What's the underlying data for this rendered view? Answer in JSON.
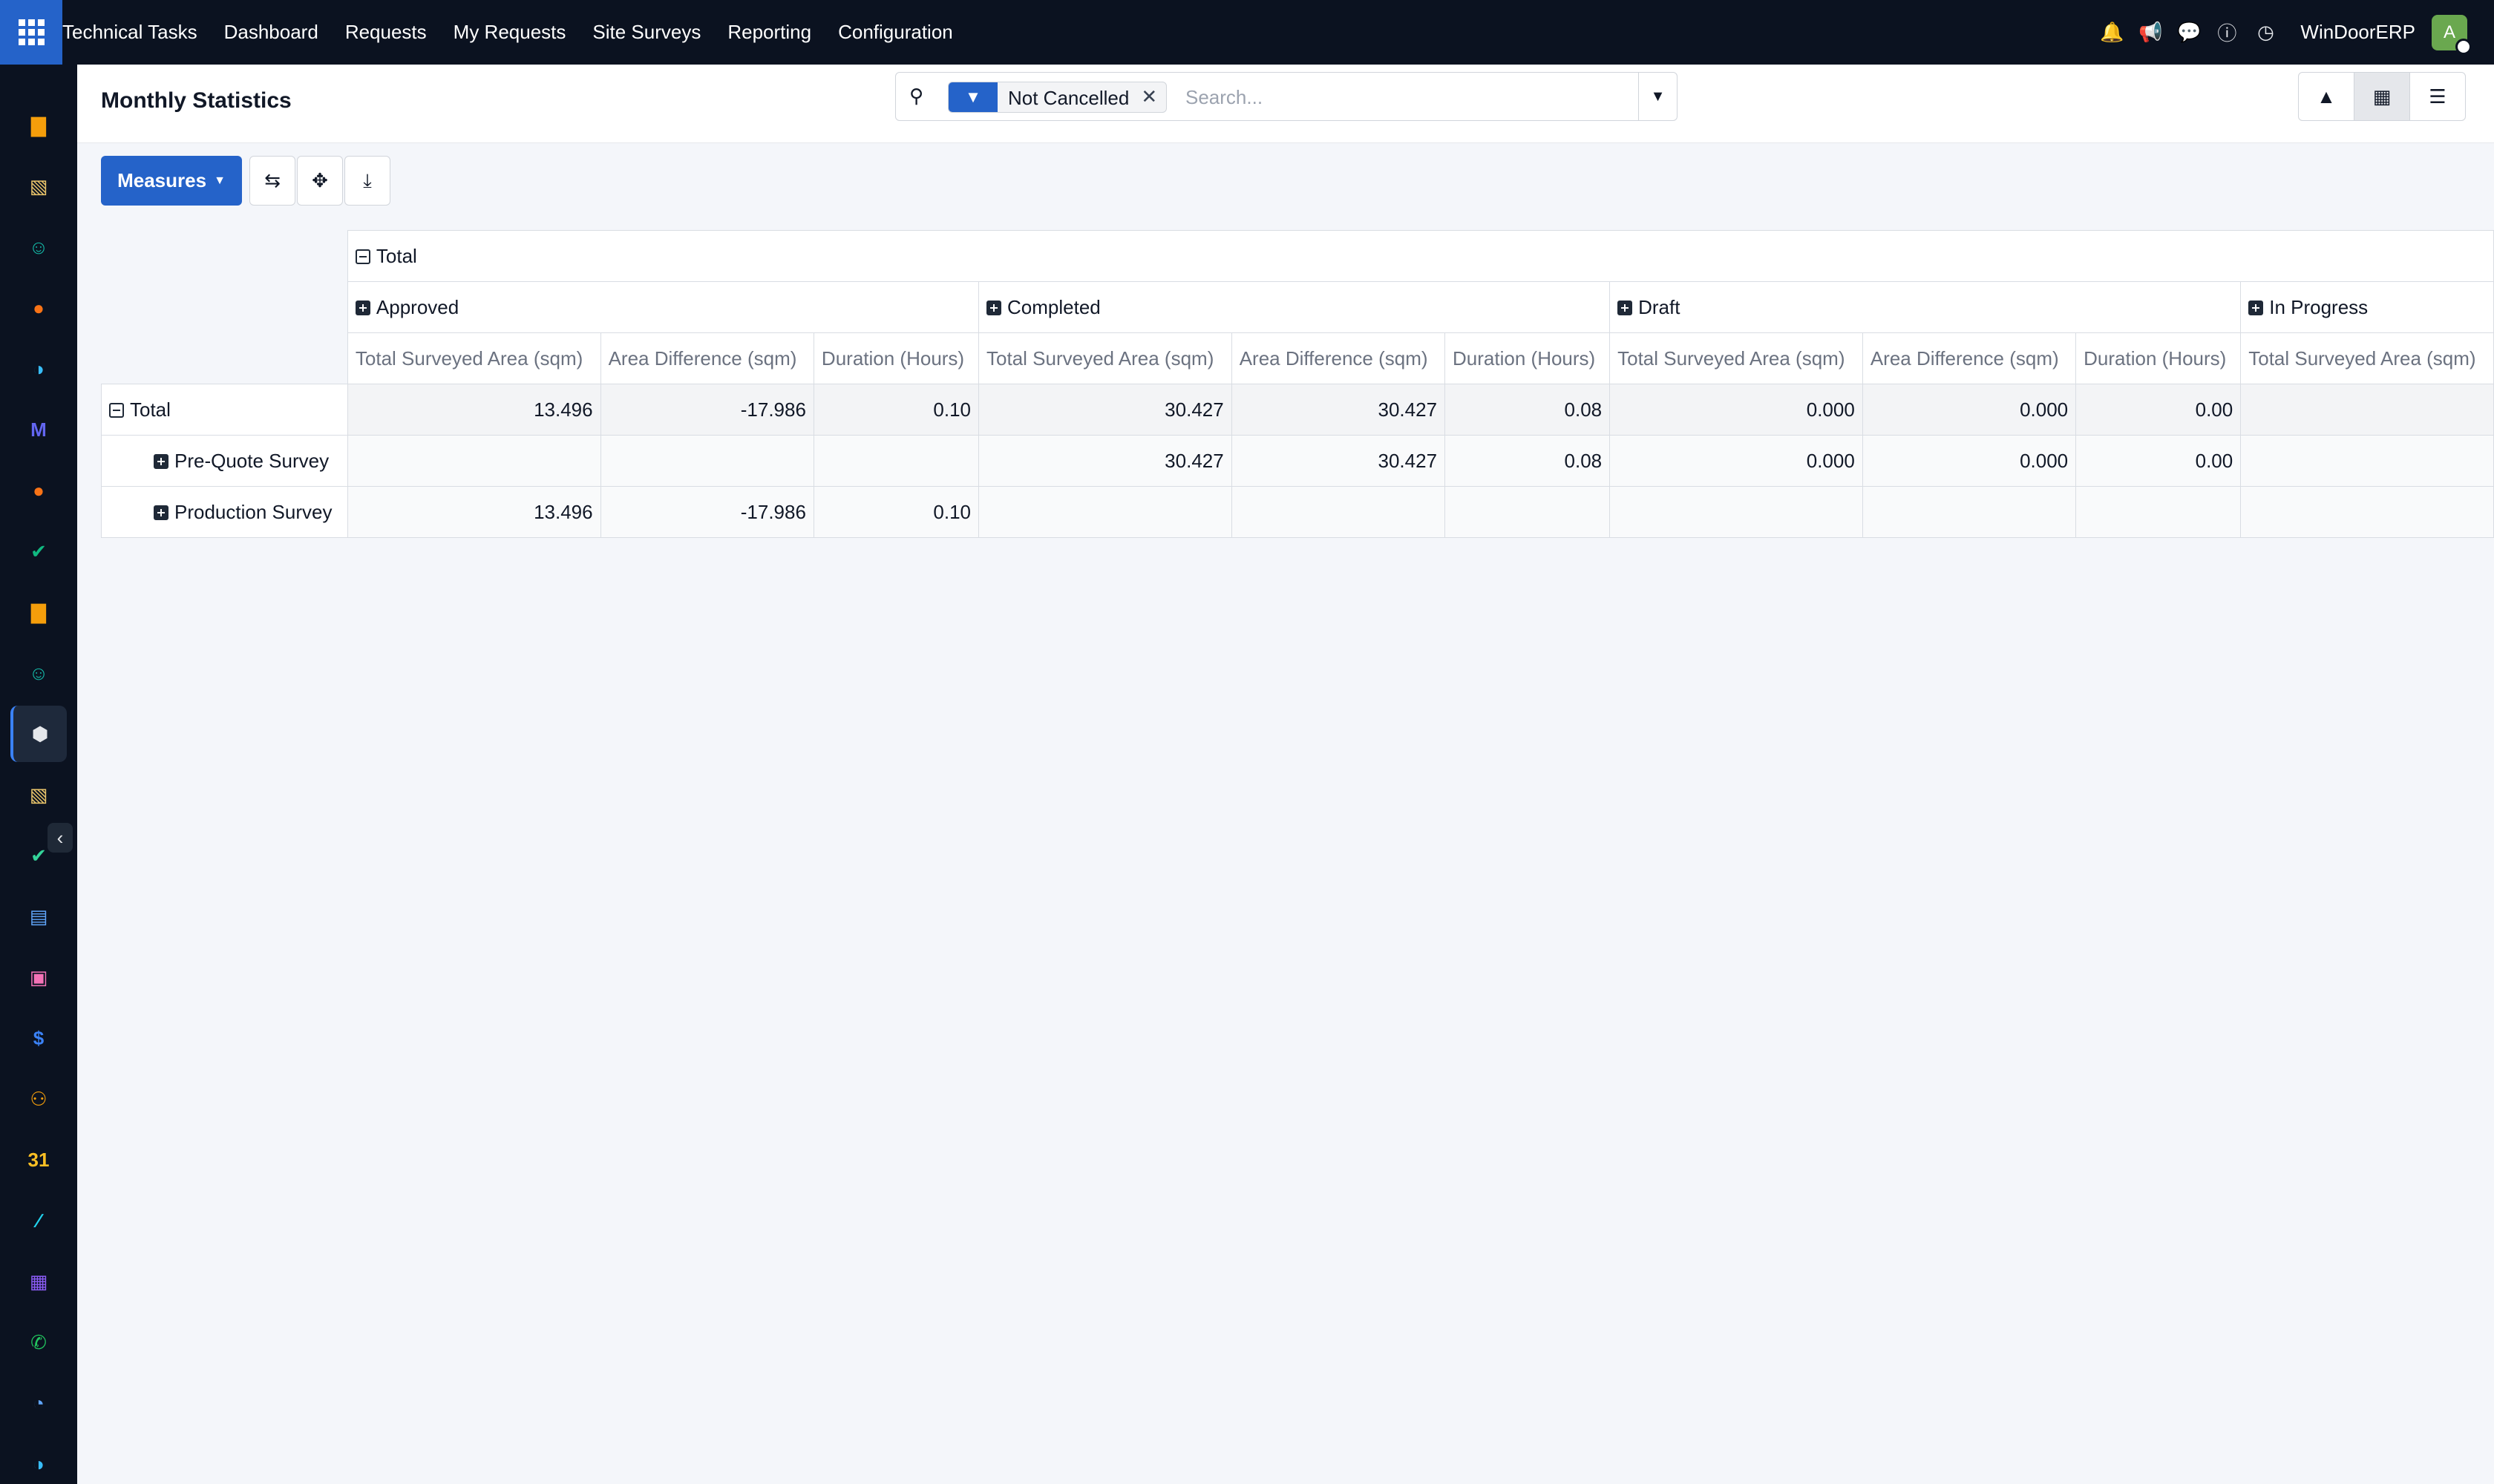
{
  "topbar": {
    "app_name": "Technical Tasks",
    "menu": [
      "Dashboard",
      "Requests",
      "My Requests",
      "Site Surveys",
      "Reporting",
      "Configuration"
    ],
    "company": "WinDoorERP",
    "avatar_letter": "A",
    "icons": [
      "bell-icon",
      "megaphone-icon",
      "chat-icon",
      "help-icon",
      "clock-icon"
    ]
  },
  "sidebar": {
    "apps": [
      {
        "icon": "chart-bars-icon",
        "color": "#f59e0b"
      },
      {
        "icon": "tickets-icon",
        "color": "#e9c46a"
      },
      {
        "icon": "contacts-icon",
        "color": "#14b8a6"
      },
      {
        "icon": "chat-bubble-icon",
        "color": "#f97316"
      },
      {
        "icon": "sphere-icon",
        "color": "#38bdf8"
      },
      {
        "icon": "mail-m-icon",
        "color": "#6366f1"
      },
      {
        "icon": "chat-bubble-icon",
        "color": "#f97316"
      },
      {
        "icon": "check-fold-icon",
        "color": "#10b981"
      },
      {
        "icon": "chart-bars-icon",
        "color": "#f59e0b"
      },
      {
        "icon": "contacts-icon",
        "color": "#14b8a6"
      },
      {
        "icon": "cube-icon",
        "color": "#e5e7eb"
      },
      {
        "icon": "tickets-icon",
        "color": "#e9c46a"
      },
      {
        "icon": "check-icon",
        "color": "#34d399"
      },
      {
        "icon": "book-icon",
        "color": "#60a5fa"
      },
      {
        "icon": "box-icon",
        "color": "#f472b6"
      },
      {
        "icon": "dollar-icon",
        "color": "#3b82f6"
      },
      {
        "icon": "people-icon",
        "color": "#f59e0b"
      },
      {
        "icon": "calendar-31-icon",
        "color": "#fbbf24"
      },
      {
        "icon": "sign-icon",
        "color": "#22d3ee"
      },
      {
        "icon": "dashboard-icon",
        "color": "#8b5cf6"
      },
      {
        "icon": "whatsapp-icon",
        "color": "#22c55e"
      },
      {
        "icon": "gauge-icon",
        "color": "#60a5fa"
      },
      {
        "icon": "sphere-icon",
        "color": "#38bdf8"
      }
    ],
    "active_index": 10
  },
  "control_panel": {
    "title": "Monthly Statistics",
    "facet_label": "Not Cancelled",
    "search_placeholder": "Search...",
    "view_active": "pivot"
  },
  "toolbar": {
    "measures_label": "Measures"
  },
  "pivot": {
    "column_root": "Total",
    "column_groups": [
      "Approved",
      "Completed",
      "Draft",
      "In Progress"
    ],
    "measures": [
      "Total Surveyed Area (sqm)",
      "Area Difference (sqm)",
      "Duration (Hours)"
    ],
    "rows": [
      {
        "label": "Total",
        "expanded": true,
        "level": 0,
        "values": [
          "13.496",
          "-17.986",
          "0.10",
          "30.427",
          "30.427",
          "0.08",
          "0.000",
          "0.000",
          "0.00",
          ""
        ]
      },
      {
        "label": "Pre-Quote Survey",
        "expanded": false,
        "level": 1,
        "values": [
          "",
          "",
          "",
          "30.427",
          "30.427",
          "0.08",
          "0.000",
          "0.000",
          "0.00",
          ""
        ]
      },
      {
        "label": "Production Survey",
        "expanded": false,
        "level": 1,
        "values": [
          "13.496",
          "-17.986",
          "0.10",
          "",
          "",
          "",
          "",
          "",
          "",
          ""
        ]
      }
    ]
  }
}
